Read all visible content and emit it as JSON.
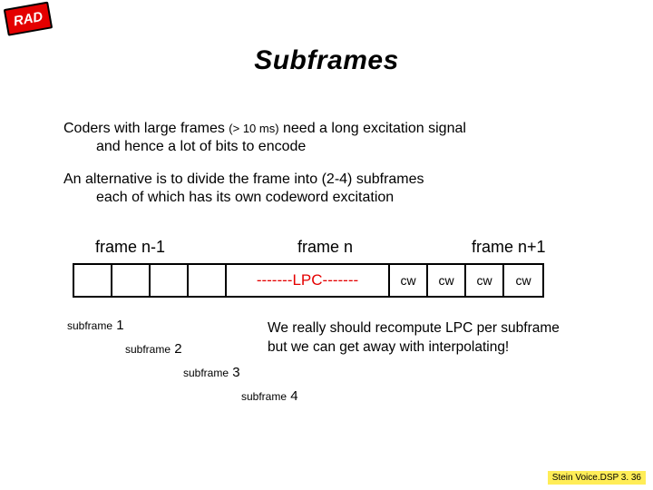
{
  "logo": {
    "text": "RAD"
  },
  "title": "Subframes",
  "para1": {
    "l1a": "Coders with large frames ",
    "l1b": "(> 10 ms)",
    "l1c": " need a long excitation signal",
    "l2": "and hence a lot of bits to encode"
  },
  "para2": {
    "l1": "An alternative is to divide the frame into (2-4) subframes",
    "l2": "each of which has its own codeword excitation"
  },
  "frame_labels": {
    "prev": "frame n-1",
    "curr": "frame n",
    "next": "frame n+1"
  },
  "diagram": {
    "lpc": "-------LPC-------",
    "cw": "cw"
  },
  "subframe_labels": {
    "s1": {
      "word": "subframe",
      "num": " 1"
    },
    "s2": {
      "word": "subframe",
      "num": " 2"
    },
    "s3": {
      "word": "subframe",
      "num": " 3"
    },
    "s4": {
      "word": "subframe",
      "num": " 4"
    }
  },
  "note": {
    "l1": "We really should recompute LPC per subframe",
    "l2": "but we can get away with interpolating!"
  },
  "footer": "Stein Voice.DSP 3. 36"
}
